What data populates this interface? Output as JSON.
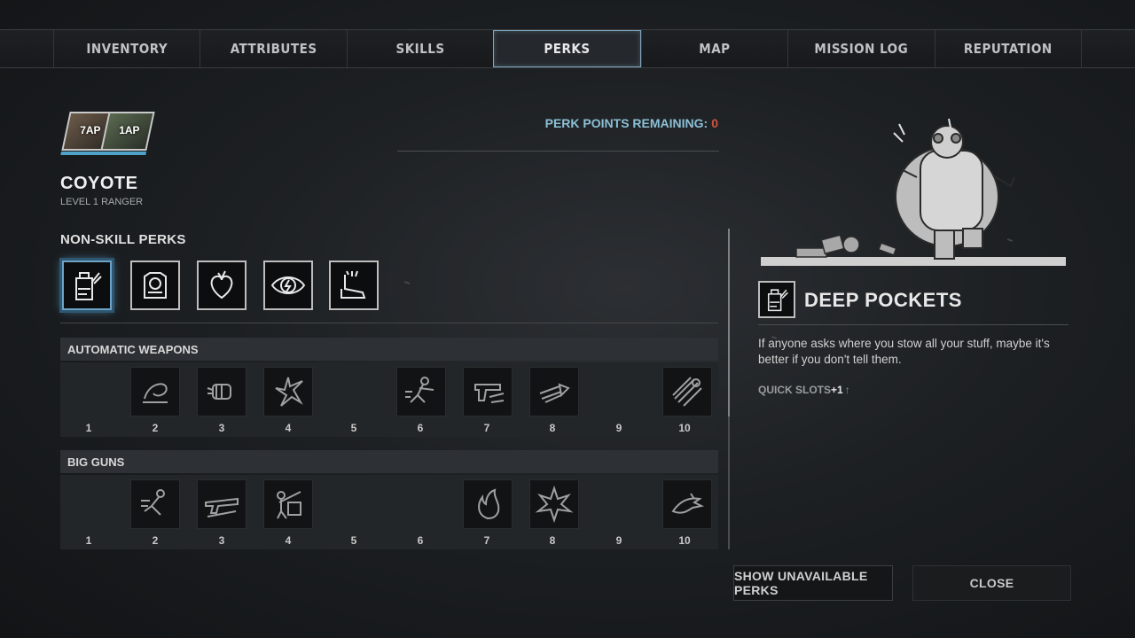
{
  "tabs": [
    {
      "label": "INVENTORY",
      "active": false
    },
    {
      "label": "ATTRIBUTES",
      "active": false
    },
    {
      "label": "SKILLS",
      "active": false
    },
    {
      "label": "PERKS",
      "active": true
    },
    {
      "label": "MAP",
      "active": false
    },
    {
      "label": "MISSION LOG",
      "active": false
    },
    {
      "label": "REPUTATION",
      "active": false
    }
  ],
  "party": [
    {
      "ap": "7AP"
    },
    {
      "ap": "1AP"
    }
  ],
  "character": {
    "name": "COYOTE",
    "level": "LEVEL 1 RANGER"
  },
  "perk_points": {
    "label": "PERK POINTS REMAINING:",
    "value": "0"
  },
  "non_skill": {
    "title": "NON-SKILL PERKS",
    "icons": [
      "deep-pockets-icon",
      "armor-vest-icon",
      "heart-icon",
      "energy-eye-icon",
      "boot-icon"
    ]
  },
  "categories": [
    {
      "title": "AUTOMATIC WEAPONS",
      "slots": [
        {
          "num": "1",
          "icon": null
        },
        {
          "num": "2",
          "icon": "swirl-icon"
        },
        {
          "num": "3",
          "icon": "fist-icon"
        },
        {
          "num": "4",
          "icon": "shatter-icon"
        },
        {
          "num": "5",
          "icon": null
        },
        {
          "num": "6",
          "icon": "soldier-icon"
        },
        {
          "num": "7",
          "icon": "pistol-icon"
        },
        {
          "num": "8",
          "icon": "bullet-icon"
        },
        {
          "num": "9",
          "icon": null
        },
        {
          "num": "10",
          "icon": "burst-icon"
        }
      ]
    },
    {
      "title": "BIG GUNS",
      "slots": [
        {
          "num": "1",
          "icon": null
        },
        {
          "num": "2",
          "icon": "runner-icon"
        },
        {
          "num": "3",
          "icon": "rifle-icon"
        },
        {
          "num": "4",
          "icon": "gunner-icon"
        },
        {
          "num": "5",
          "icon": null
        },
        {
          "num": "6",
          "icon": null
        },
        {
          "num": "7",
          "icon": "fire-icon"
        },
        {
          "num": "8",
          "icon": "explosion-icon"
        },
        {
          "num": "9",
          "icon": null
        },
        {
          "num": "10",
          "icon": "dragon-icon"
        }
      ]
    }
  ],
  "detail": {
    "title": "DEEP POCKETS",
    "description": "If anyone asks where you stow all your stuff, maybe it's better if you don't tell them.",
    "stat_label": "QUICK SLOTS",
    "stat_value": "+1",
    "stat_arrow": "↑"
  },
  "buttons": {
    "show_unavailable": "SHOW UNAVAILABLE PERKS",
    "close": "CLOSE"
  },
  "colors": {
    "accent": "#7fa6c0",
    "points_zero": "#d0533d",
    "points_label": "#8cc0d6",
    "stat_up": "#6fb04a"
  }
}
